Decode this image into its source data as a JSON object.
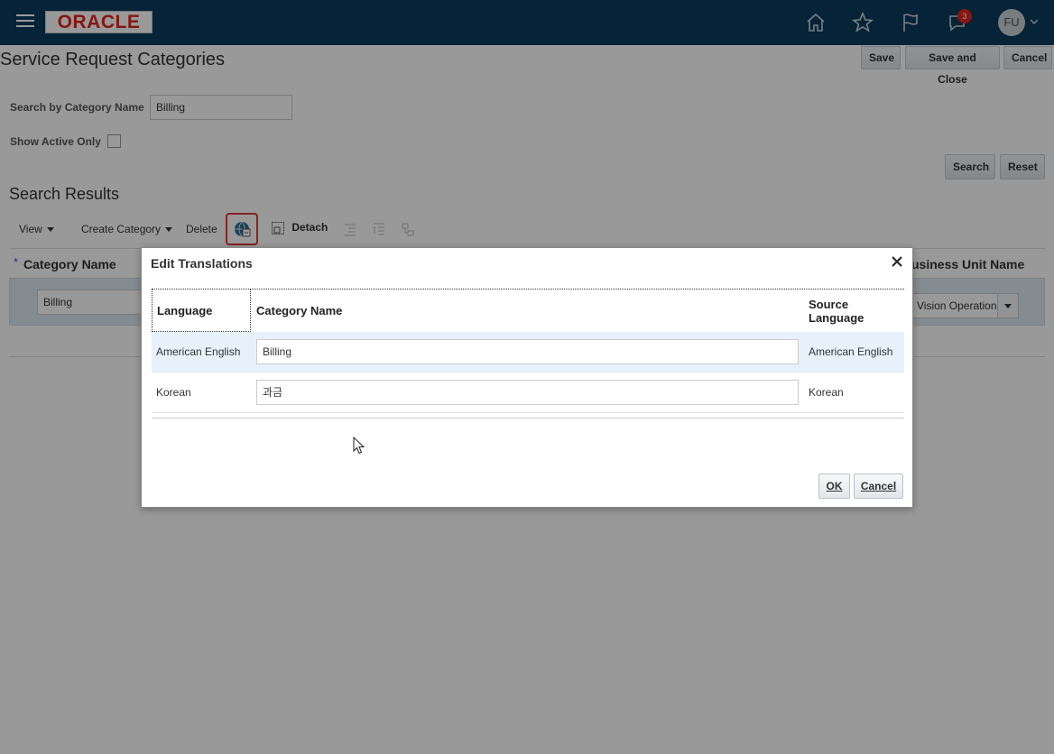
{
  "header": {
    "logo_text": "ORACLE",
    "notification_count": "3",
    "user_initials": "FU",
    "brand_color": "#0b3b5e"
  },
  "page": {
    "title": "Service Request Categories",
    "save_label": "Save",
    "save_and_close_label": "Save and Close",
    "cancel_label": "Cancel"
  },
  "search": {
    "category_label": "Search by Category Name",
    "category_value": "Billing",
    "active_only_label": "Show Active Only",
    "search_label": "Search",
    "reset_label": "Reset"
  },
  "results": {
    "title": "Search Results",
    "toolbar": {
      "view_label": "View",
      "create_label": "Create Category",
      "delete_label": "Delete",
      "detach_label": "Detach"
    },
    "columns": {
      "category_name": "Category Name",
      "business_unit_name": "usiness Unit Name"
    },
    "required_mark": "*",
    "row": {
      "category_name": "Billing",
      "business_unit": "Vision Operation"
    }
  },
  "dialog": {
    "title": "Edit Translations",
    "columns": {
      "language": "Language",
      "category_name": "Category Name",
      "source_language_line1": "Source",
      "source_language_line2": "Language"
    },
    "rows": [
      {
        "language": "American English",
        "category_name": "Billing",
        "source_language": "American English"
      },
      {
        "language": "Korean",
        "category_name": "과금",
        "source_language": "Korean"
      }
    ],
    "ok_label": "OK",
    "cancel_label": "Cancel"
  }
}
